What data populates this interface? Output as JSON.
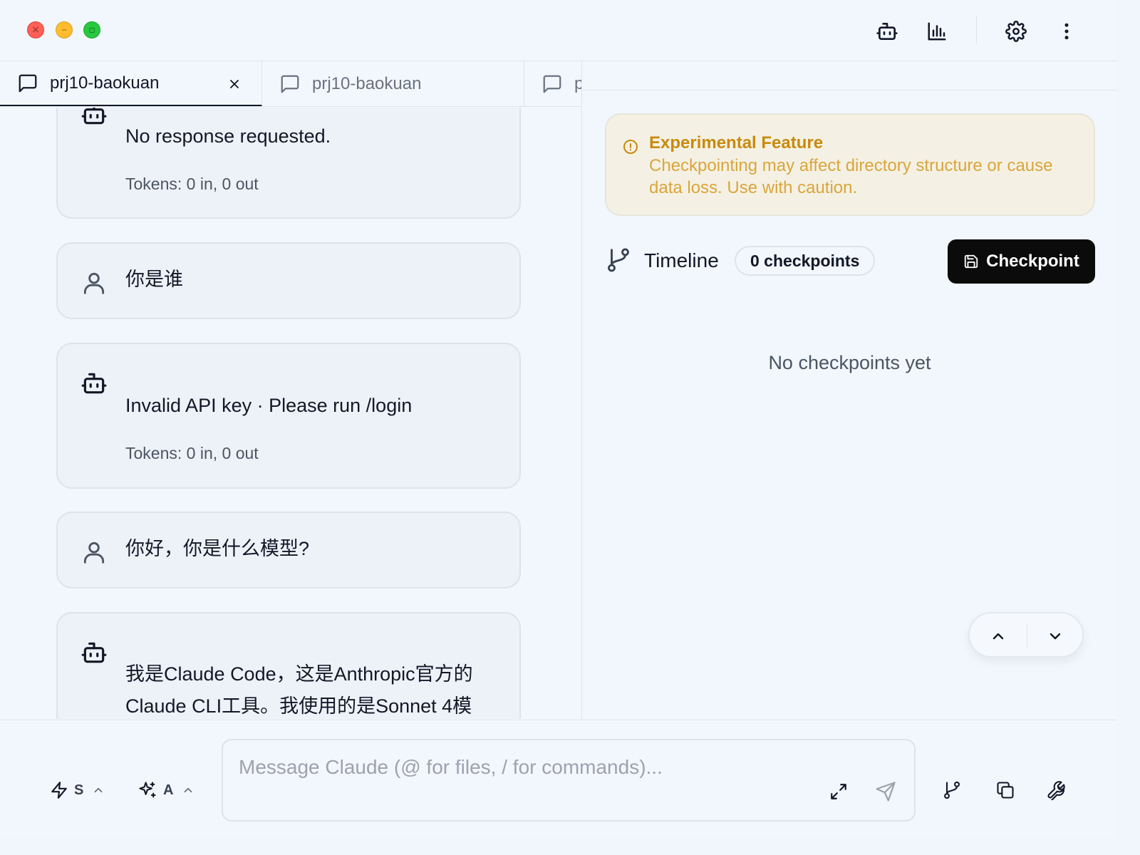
{
  "tabs": [
    {
      "label": "prj10-baokuan",
      "active": true
    },
    {
      "label": "prj10-baokuan",
      "active": false
    },
    {
      "label": "p",
      "active": false
    }
  ],
  "messages": [
    {
      "role": "assistant",
      "text": "No response requested.",
      "tokens": "Tokens: 0 in, 0 out"
    },
    {
      "role": "user",
      "text": "你是谁"
    },
    {
      "role": "assistant",
      "text": "Invalid API key · Please run /login",
      "tokens": "Tokens: 0 in, 0 out"
    },
    {
      "role": "user",
      "text": "你好，你是什么模型?"
    },
    {
      "role": "assistant",
      "text_lines": [
        "我是Claude Code，这是Anthropic官方的",
        "Claude CLI工具。我使用的是Sonnet 4模"
      ]
    }
  ],
  "alert": {
    "title": "Experimental Feature",
    "body": "Checkpointing may affect directory structure or cause data loss. Use with caution."
  },
  "timeline": {
    "label": "Timeline",
    "badge": "0 checkpoints",
    "button_label": "Checkpoint",
    "empty_text": "No checkpoints yet"
  },
  "bottom": {
    "model_label": "S",
    "thinking_label": "A",
    "input_placeholder": "Message Claude (@ for files, / for commands)..."
  },
  "icons": {
    "titlebar": [
      "agent-icon",
      "usage-chart-icon",
      "settings-gear-icon",
      "more-vertical-icon"
    ],
    "tab": [
      "chat-bubble-icon",
      "close-icon"
    ],
    "bottom": [
      "zap-icon",
      "sparkles-icon",
      "expand-icon",
      "send-icon",
      "branch-icon",
      "copy-icon",
      "wrench-icon"
    ]
  },
  "colors": {
    "primary_button": "#0b0b0c",
    "warning_title": "#c98a0d",
    "warning_text": "#dba53a",
    "warning_bg": "#f4f1e4"
  }
}
